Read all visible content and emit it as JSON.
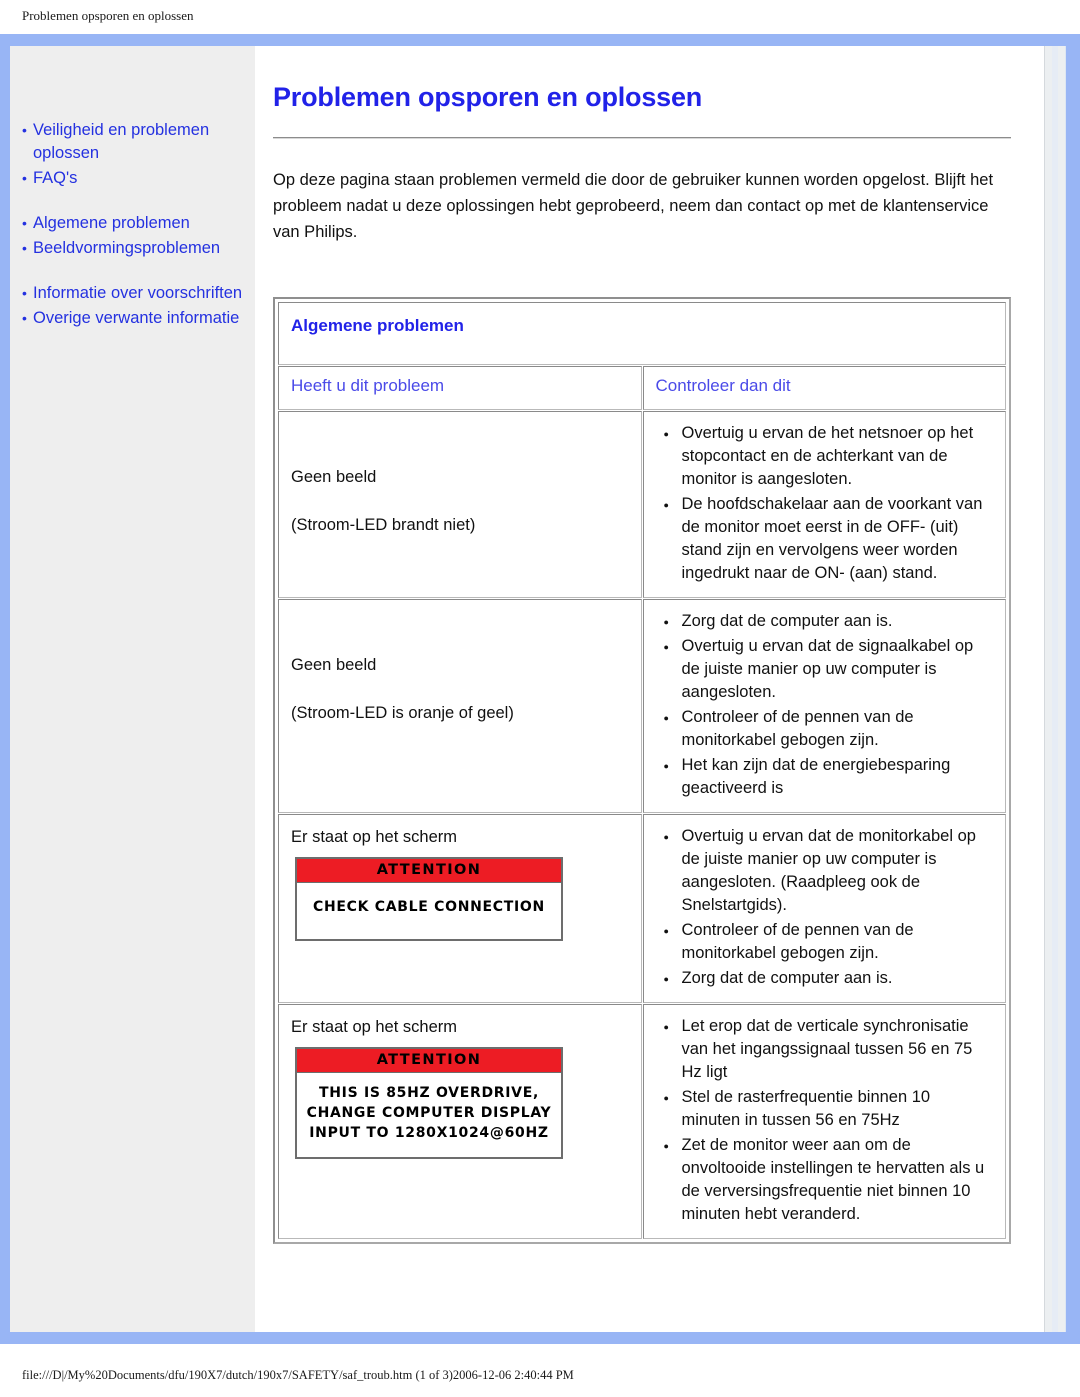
{
  "print": {
    "header_title": "Problemen opsporen en oplossen",
    "footer_path": "file:///D|/My%20Documents/dfu/190X7/dutch/190x7/SAFETY/saf_troub.htm (1 of 3)2006-12-06 2:40:44 PM"
  },
  "colors": {
    "frame_blue": "#98b5f5",
    "link_blue": "#2431e0",
    "heading_blue": "#2122e8",
    "attention_red": "#ed1c24",
    "sidebar_bg": "#eeeeee"
  },
  "sidebar": {
    "groups": [
      {
        "items": [
          {
            "label": "Veiligheid en problemen oplossen"
          },
          {
            "label": "FAQ's"
          }
        ]
      },
      {
        "items": [
          {
            "label": "Algemene problemen"
          },
          {
            "label": "Beeldvormingsproblemen"
          }
        ]
      },
      {
        "items": [
          {
            "label": "Informatie over voorschriften"
          },
          {
            "label": "Overige verwante informatie"
          }
        ]
      }
    ]
  },
  "main": {
    "title": "Problemen opsporen en oplossen",
    "intro": "Op deze pagina staan problemen vermeld die door de gebruiker kunnen worden opgelost. Blijft het probleem nadat u deze oplossingen hebt geprobeerd, neem dan contact op met de klantenservice van Philips.",
    "table": {
      "section_heading": "Algemene problemen",
      "col_headers": {
        "problem": "Heeft u dit probleem",
        "check": "Controleer dan dit"
      },
      "rows": [
        {
          "problem_line1": "Geen beeld",
          "problem_line2": "(Stroom-LED brandt niet)",
          "checks": [
            "Overtuig u ervan de het netsnoer op het stopcontact en de achterkant van de monitor is aangesloten.",
            "De hoofdschakelaar aan de voorkant van de monitor moet eerst in de OFF- (uit) stand zijn en vervolgens weer worden ingedrukt naar de ON- (aan) stand."
          ]
        },
        {
          "problem_line1": "Geen beeld",
          "problem_line2": "(Stroom-LED is oranje of geel)",
          "checks": [
            "Zorg dat de computer aan is.",
            "Overtuig u ervan dat de signaalkabel op de juiste manier op uw computer is aangesloten.",
            "Controleer of de pennen van de monitorkabel gebogen zijn.",
            "Het kan zijn dat de energiebesparing geactiveerd is"
          ]
        },
        {
          "problem_line1": "Er staat op het scherm",
          "osd": {
            "title": "ATTENTION",
            "lines": [
              "CHECK CABLE CONNECTION"
            ]
          },
          "checks": [
            "Overtuig u ervan dat de monitorkabel op de juiste manier op uw computer is aangesloten. (Raadpleeg ook de Snelstartgids).",
            "Controleer of de pennen van de monitorkabel gebogen zijn.",
            "Zorg dat de computer aan is."
          ]
        },
        {
          "problem_line1": "Er staat op het scherm",
          "osd": {
            "title": "ATTENTION",
            "lines": [
              "THIS IS 85HZ OVERDRIVE,",
              "CHANGE COMPUTER DISPLAY",
              "INPUT TO 1280X1024@60HZ"
            ]
          },
          "checks": [
            "Let erop dat de verticale synchronisatie van het ingangssignaal tussen 56 en 75 Hz ligt",
            "Stel de rasterfrequentie binnen 10 minuten in tussen 56 en 75Hz",
            "Zet de monitor weer aan om de onvoltooide instellingen te hervatten als u de verversingsfrequentie niet binnen 10 minuten hebt veranderd."
          ]
        }
      ]
    }
  }
}
